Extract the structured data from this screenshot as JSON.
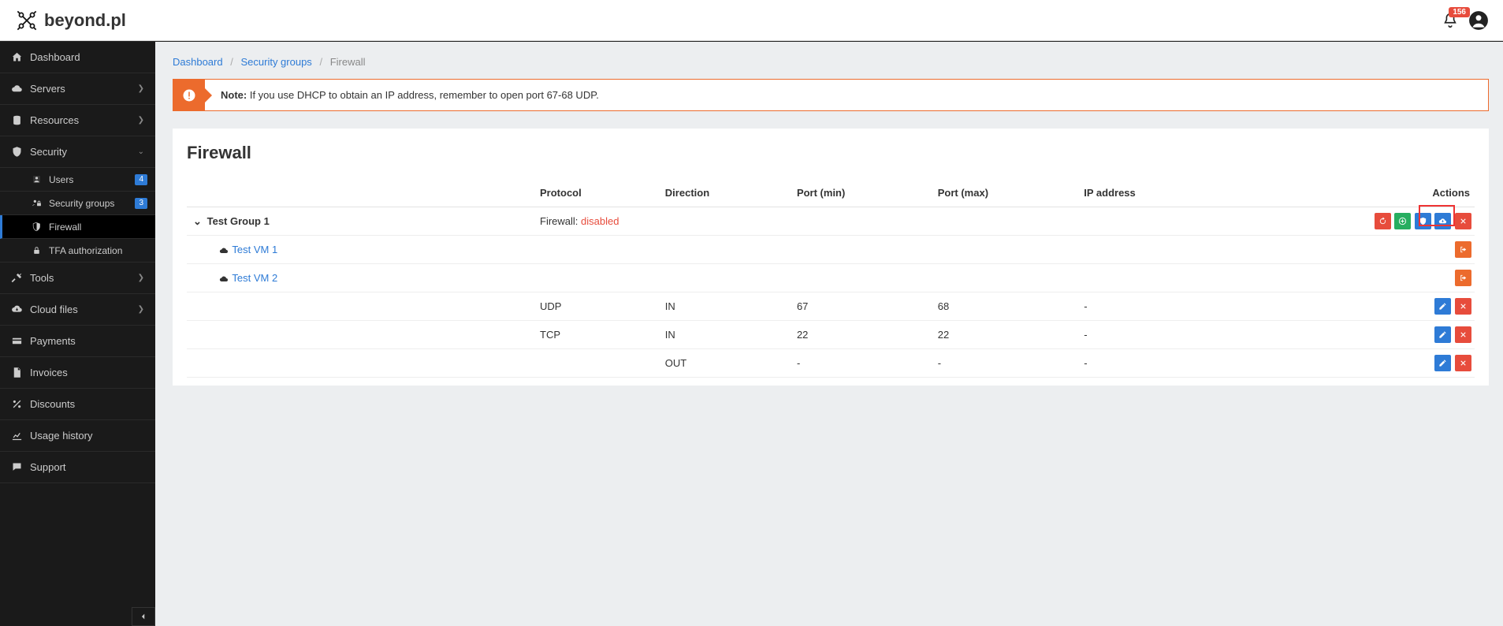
{
  "brand": "beyond.pl",
  "notif_count": "156",
  "breadcrumb": {
    "root": "Dashboard",
    "group": "Security groups",
    "current": "Firewall"
  },
  "alert": {
    "prefix": "Note:",
    "text": "If you use DHCP to obtain an IP address, remember to open port 67-68 UDP."
  },
  "page_title": "Firewall",
  "sidebar": {
    "dashboard": "Dashboard",
    "servers": "Servers",
    "resources": "Resources",
    "security": "Security",
    "users": "Users",
    "users_count": "4",
    "security_groups": "Security groups",
    "sg_count": "3",
    "firewall": "Firewall",
    "tfa": "TFA authorization",
    "tools": "Tools",
    "cloud": "Cloud files",
    "payments": "Payments",
    "invoices": "Invoices",
    "discounts": "Discounts",
    "usage": "Usage history",
    "support": "Support"
  },
  "columns": {
    "protocol": "Protocol",
    "direction": "Direction",
    "pmin": "Port (min)",
    "pmax": "Port (max)",
    "ip": "IP address",
    "actions": "Actions"
  },
  "group": {
    "name": "Test Group 1",
    "fw_label": "Firewall: ",
    "fw_status": "disabled",
    "vms": [
      {
        "name": "Test VM 1"
      },
      {
        "name": "Test VM 2"
      }
    ],
    "rules": [
      {
        "proto": "UDP",
        "dir": "IN",
        "pmin": "67",
        "pmax": "68",
        "ip": "-"
      },
      {
        "proto": "TCP",
        "dir": "IN",
        "pmin": "22",
        "pmax": "22",
        "ip": "-"
      },
      {
        "proto": "",
        "dir": "OUT",
        "pmin": "-",
        "pmax": "-",
        "ip": "-"
      }
    ]
  }
}
